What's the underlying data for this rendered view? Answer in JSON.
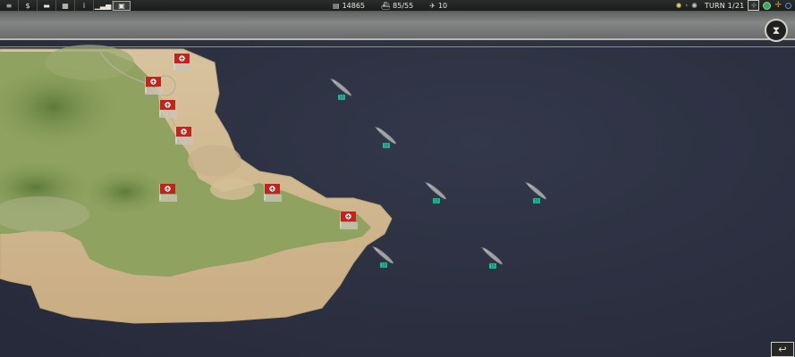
{
  "toolbar": {
    "buttons": [
      {
        "name": "settings-button",
        "icon": "≡"
      },
      {
        "name": "finance-button",
        "icon": "$"
      },
      {
        "name": "messages-button",
        "icon": "▬"
      },
      {
        "name": "grid-menu-button",
        "icon": "▦"
      },
      {
        "name": "info-button",
        "icon": "i"
      },
      {
        "name": "stats-button",
        "icon": "▁▃▅"
      },
      {
        "name": "screen-button",
        "icon": "▣"
      }
    ]
  },
  "resources": {
    "prestige": "14865",
    "units": "85/55",
    "aircraft": "10"
  },
  "turn": {
    "label": "TURN 1/21"
  },
  "colors": {
    "sea": "#2d3244",
    "land_green": "#8ea063",
    "sand": "#d8bf96",
    "flag_red": "#c3231d",
    "label_teal": "#1fc8a4"
  },
  "units": [
    {
      "type": "ship",
      "label": "10"
    },
    {
      "type": "ship",
      "label": "10"
    },
    {
      "type": "ship",
      "label": "10"
    },
    {
      "type": "ship",
      "label": "10"
    },
    {
      "type": "ship",
      "label": "10"
    },
    {
      "type": "ship",
      "label": "10"
    }
  ],
  "cities": [
    {
      "owner": "germany"
    },
    {
      "owner": "germany"
    },
    {
      "owner": "germany"
    },
    {
      "owner": "germany"
    },
    {
      "owner": "germany"
    },
    {
      "owner": "germany"
    },
    {
      "owner": "germany"
    }
  ]
}
